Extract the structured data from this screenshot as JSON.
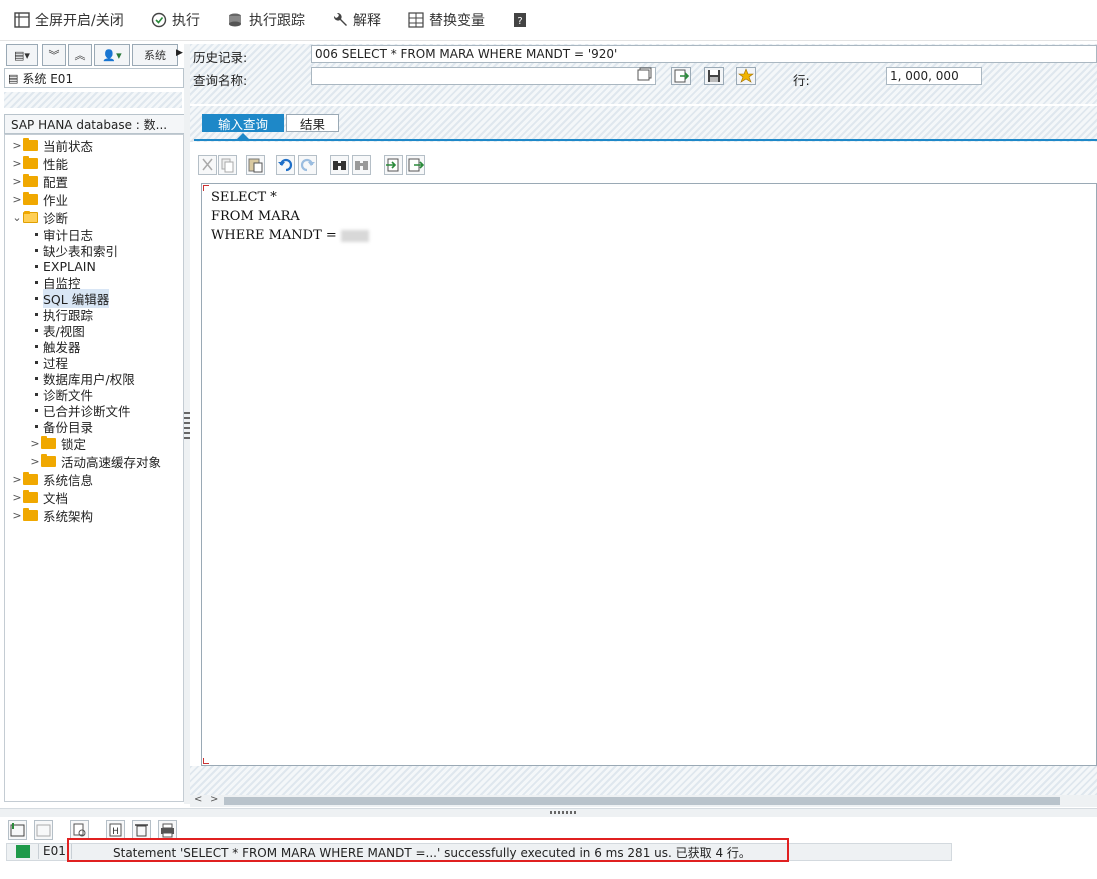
{
  "toolbar": {
    "fullscreen": "全屏开启/关闭",
    "execute": "执行",
    "trace": "执行跟踪",
    "explain": "解释",
    "replace_vars": "替换变量"
  },
  "left": {
    "system_btn": "系统",
    "system_label": "系统 E01",
    "tree_header": "SAP HANA database : 数...",
    "tree": [
      {
        "label": "当前状态",
        "type": "folder"
      },
      {
        "label": "性能",
        "type": "folder"
      },
      {
        "label": "配置",
        "type": "folder"
      },
      {
        "label": "作业",
        "type": "folder"
      },
      {
        "label": "诊断",
        "type": "folder-open"
      },
      {
        "label": "审计日志",
        "type": "leaf"
      },
      {
        "label": "缺少表和索引",
        "type": "leaf"
      },
      {
        "label": "EXPLAIN",
        "type": "leaf"
      },
      {
        "label": "自监控",
        "type": "leaf"
      },
      {
        "label": "SQL 编辑器",
        "type": "leaf",
        "selected": true
      },
      {
        "label": "执行跟踪",
        "type": "leaf"
      },
      {
        "label": "表/视图",
        "type": "leaf"
      },
      {
        "label": "触发器",
        "type": "leaf"
      },
      {
        "label": "过程",
        "type": "leaf"
      },
      {
        "label": "数据库用户/权限",
        "type": "leaf"
      },
      {
        "label": "诊断文件",
        "type": "leaf"
      },
      {
        "label": "已合并诊断文件",
        "type": "leaf"
      },
      {
        "label": "备份目录",
        "type": "leaf"
      },
      {
        "label": "锁定",
        "type": "subfolder"
      },
      {
        "label": "活动高速缓存对象",
        "type": "subfolder"
      },
      {
        "label": "系统信息",
        "type": "folder"
      },
      {
        "label": "文档",
        "type": "folder"
      },
      {
        "label": "系统架构",
        "type": "folder"
      }
    ]
  },
  "query": {
    "history_label": "历史记录:",
    "history_value": "006 SELECT * FROM MARA WHERE MANDT = '920'",
    "name_label": "查询名称:",
    "name_value": "",
    "rows_label": "行:",
    "rows_value": "1, 000, 000"
  },
  "tabs": [
    {
      "label": "输入查询",
      "active": true
    },
    {
      "label": "结果",
      "active": false
    }
  ],
  "editor": {
    "lines": [
      "SELECT *",
      "FROM MARA",
      "WHERE MANDT = "
    ]
  },
  "status": {
    "system": "E01",
    "message": "Statement 'SELECT * FROM MARA WHERE MANDT =...' successfully executed in 6 ms 281 us. 已获取 4 行。",
    "ok_color": "#1f9a4a",
    "highlight_color": "#e02020",
    "accent": "#1e88c8"
  }
}
